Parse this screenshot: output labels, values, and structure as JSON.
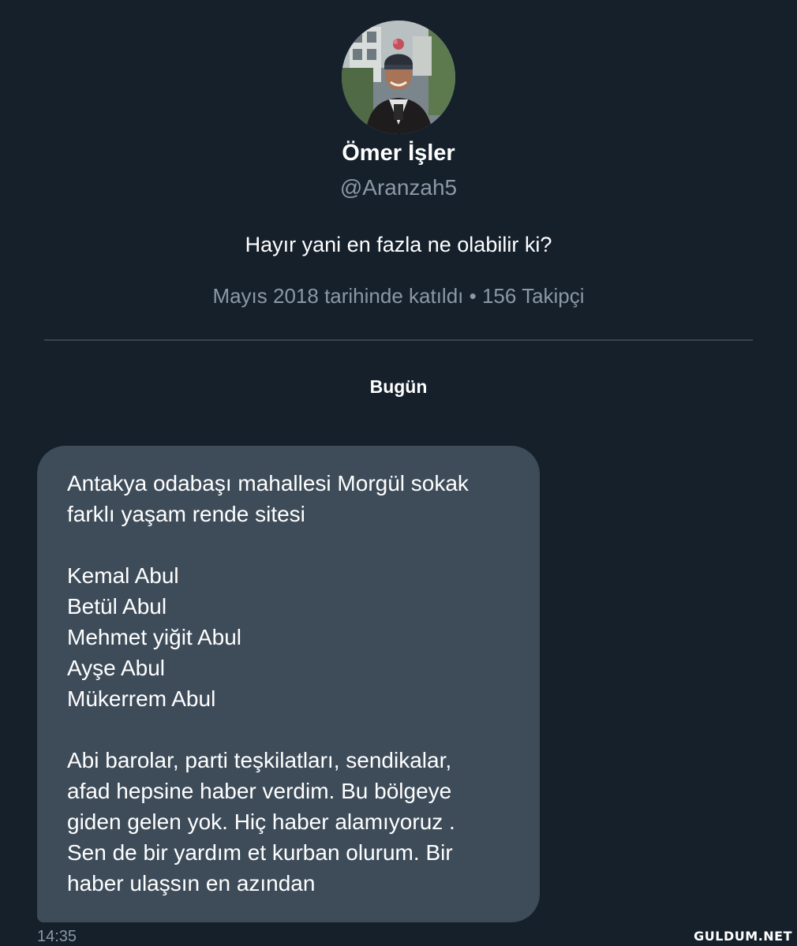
{
  "profile": {
    "display_name": "Ömer İşler",
    "handle": "@Aranzah5",
    "bio": "Hayır yani en fazla ne olabilir ki?",
    "meta": "Mayıs 2018 tarihinde katıldı • 156 Takipçi"
  },
  "conversation": {
    "date_separator": "Bugün",
    "message": {
      "lines": [
        "Antakya odabaşı mahallesi Morgül sokak",
        "farklı yaşam rende sitesi",
        "",
        "Kemal Abul",
        "Betül Abul",
        "Mehmet yiğit Abul",
        "Ayşe Abul",
        "Mükerrem Abul",
        "",
        "Abi barolar, parti teşkilatları, sendikalar,",
        "afad hepsine haber verdim. Bu bölgeye",
        "giden gelen yok. Hiç haber alamıyoruz .",
        "Sen de bir yardım et kurban olurum. Bir",
        "haber ulaşsın en azından"
      ],
      "time": "14:35"
    }
  },
  "watermark": "GULDUM.NET",
  "colors": {
    "background": "#15202b",
    "bubble": "#3e4c5a",
    "secondary_text": "#8b98a5",
    "divider": "#38444d"
  }
}
